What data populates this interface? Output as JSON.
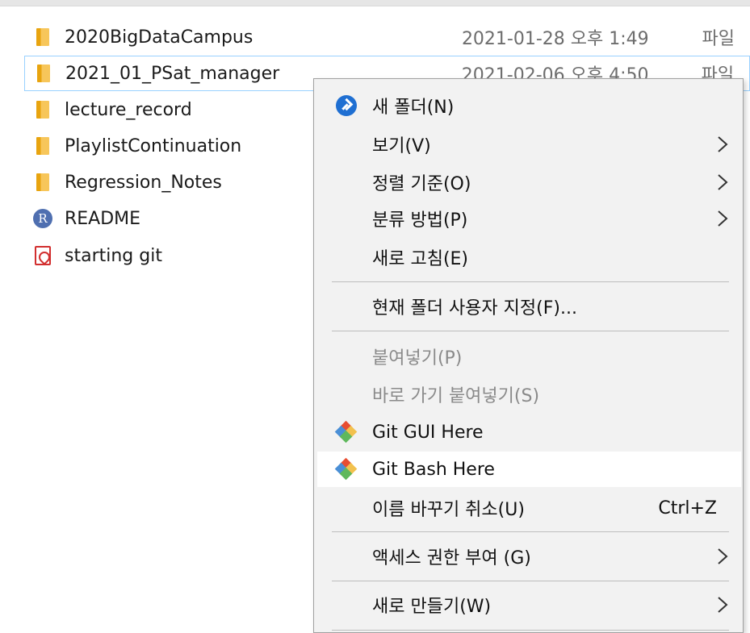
{
  "files": [
    {
      "name": "2020BigDataCampus",
      "date": "2021-01-28 오후 1:49",
      "type": "파일",
      "icon": "folder-icon",
      "selected": false
    },
    {
      "name": "2021_01_PSat_manager",
      "date": "2021-02-06 오후 4:50",
      "type": "파일",
      "icon": "folder-icon",
      "selected": true
    },
    {
      "name": "lecture_record",
      "date": "",
      "type": "",
      "icon": "folder-icon",
      "selected": false
    },
    {
      "name": "PlaylistContinuation",
      "date": "",
      "type": "",
      "icon": "folder-icon",
      "selected": false
    },
    {
      "name": "Regression_Notes",
      "date": "",
      "type": "",
      "icon": "folder-icon",
      "selected": false
    },
    {
      "name": "README",
      "date": "",
      "type": "",
      "icon": "r-file-icon",
      "selected": false
    },
    {
      "name": "starting git",
      "date": "",
      "type": "",
      "icon": "pdf-icon",
      "selected": false
    }
  ],
  "context_menu": {
    "new_folder": "새 폴더(N)",
    "view": "보기(V)",
    "sort_by": "정렬 기준(O)",
    "group_by": "분류 방법(P)",
    "refresh": "새로 고침(E)",
    "customize_folder": "현재 폴더 사용자 지정(F)...",
    "paste": "붙여넣기(P)",
    "paste_shortcut": "바로 가기 붙여넣기(S)",
    "git_gui": "Git GUI Here",
    "git_bash": "Git Bash Here",
    "undo_rename": "이름 바꾸기 취소(U)",
    "undo_shortcut": "Ctrl+Z",
    "give_access": "액세스 권한 부여 (G)",
    "new": "새로 만들기(W)"
  },
  "colors": {
    "menu_background": "#f2f2f2",
    "hover_background": "#ffffff",
    "selection_border": "#99d1ff",
    "folder_yellow": "#f7c65a"
  }
}
